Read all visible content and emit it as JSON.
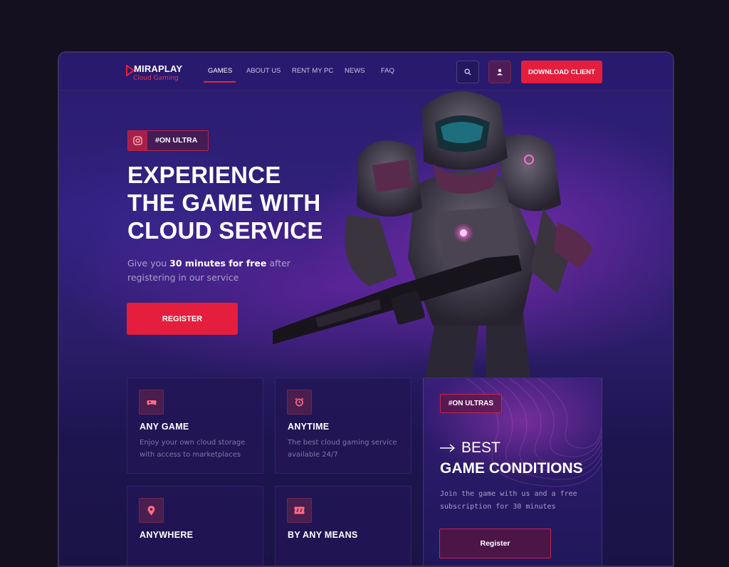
{
  "brand": {
    "name": "MIRAPLAY",
    "subtitle": "Cloud Gaming"
  },
  "nav": {
    "items": [
      {
        "label": "GAMES",
        "active": true
      },
      {
        "label": "ABOUT US"
      },
      {
        "label": "RENT MY PC"
      },
      {
        "label": "NEWS"
      },
      {
        "label": "FAQ"
      }
    ],
    "search_icon": "search-icon",
    "user_icon": "user-icon",
    "download_label": "DOWNLOAD CLIENT"
  },
  "hero": {
    "tag": "#ON ULTRA",
    "tag_icon": "instagram-icon",
    "headline": [
      "EXPERIENCE",
      "THE GAME WITH",
      "CLOUD SERVICE"
    ],
    "sub_pre": "Give you ",
    "sub_bold": "30 minutes for free",
    "sub_post": " after registering in our service",
    "register_label": "REGISTER"
  },
  "features": [
    {
      "icon": "gamepad-icon",
      "title": "ANY GAME",
      "desc": "Enjoy your own cloud storage with access to marketplaces"
    },
    {
      "icon": "alarm-clock-icon",
      "title": "ANYTIME",
      "desc": "The best cloud gaming service available 24/7"
    },
    {
      "icon": "location-pin-icon",
      "title": "ANYWHERE",
      "desc": ""
    },
    {
      "icon": "ticket-icon",
      "title": "BY ANY MEANS",
      "desc": ""
    }
  ],
  "promo": {
    "tag": "#ON ULTRAS",
    "best": "BEST",
    "title": "GAME CONDITIONS",
    "desc": "Join the game with us and a free subscription for 30 minutes",
    "button_label": "Register"
  },
  "colors": {
    "accent": "#e51e3d",
    "background": "#15101f",
    "panel": "#2a1c6e"
  }
}
